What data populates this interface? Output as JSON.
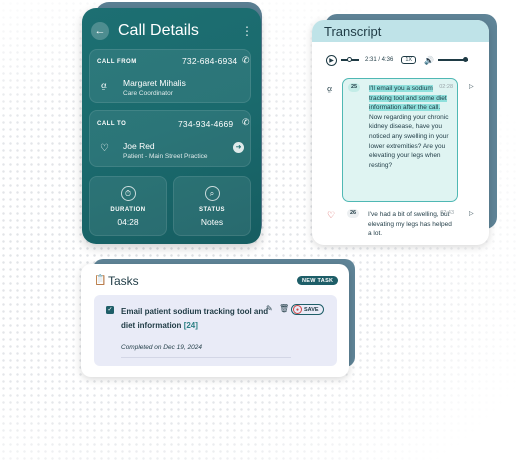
{
  "call_details": {
    "title": "Call Details",
    "call_from": {
      "label": "CALL FROM",
      "phone": "732-684-6934",
      "name": "Margaret Mihalis",
      "role": "Care Coordinator"
    },
    "call_to": {
      "label": "CALL TO",
      "phone": "734-934-4669",
      "name": "Joe Red",
      "role": "Patient - Main Street Practice"
    },
    "duration": {
      "label": "DURATION",
      "value": "04:28"
    },
    "status": {
      "label": "STATUS",
      "value": "Notes"
    }
  },
  "transcript": {
    "title": "Transcript",
    "player": {
      "time": "2:31 / 4:36",
      "speed": "1X"
    },
    "messages": [
      {
        "number": "25",
        "time": "02:28",
        "highlighted": "I'll email you a sodium tracking tool and some diet information after the call.",
        "text": "Now regarding your chronic kidney disease, have you noticed any swelling in your lower extremities? Are you elevating your legs when resting?"
      },
      {
        "number": "26",
        "time": "02:43",
        "text": "I've had a bit of swelling, but elevating my legs has helped a lot."
      }
    ]
  },
  "tasks": {
    "title": "Tasks",
    "new_task_label": "NEW TASK",
    "items": [
      {
        "text": "Email patient sodium tracking tool and diet information",
        "ref": "[24]",
        "completed": "Completed on Dec 19, 2024",
        "save_label": "SAVE",
        "checked": true
      }
    ]
  },
  "colors": {
    "teal": "#1d6f72",
    "accent": "#1e5e68",
    "highlight": "#8fe0dc",
    "header": "#bfe3e8"
  }
}
